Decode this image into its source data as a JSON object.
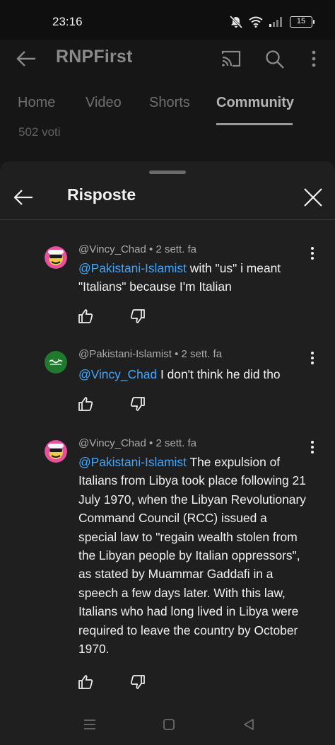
{
  "status_bar": {
    "time": "23:16",
    "battery": "15"
  },
  "header": {
    "channel_title": "RNPFirst"
  },
  "tabs": [
    {
      "label": "Home",
      "active": false
    },
    {
      "label": "Video",
      "active": false
    },
    {
      "label": "Shorts",
      "active": false
    },
    {
      "label": "Community",
      "active": true
    }
  ],
  "post": {
    "votes": "502 voti"
  },
  "sheet": {
    "title": "Risposte"
  },
  "comments": [
    {
      "author": "@Vincy_Chad",
      "time": "2 sett. fa",
      "mention": "@Pakistani-Islamist",
      "text": " with \"us\" i meant \"Italians\" because I'm Italian",
      "avatar": "cartoon-avatar"
    },
    {
      "author": "@Pakistani-Islamist",
      "time": "2 sett. fa",
      "mention": "@Vincy_Chad",
      "text": " I don't think he did tho",
      "avatar": "green-flag-avatar"
    },
    {
      "author": "@Vincy_Chad",
      "time": "2 sett. fa",
      "mention": "@Pakistani-Islamist",
      "text": " The expulsion of Italians from Libya took place following 21 July 1970, when the Libyan Revolutionary Command Council (RCC) issued a special law to \"regain wealth stolen from the Libyan people by Italian oppressors\", as stated by Muammar Gaddafi in a speech a few days later. With this law, Italians who had long lived in Libya were required to leave the country by October 1970.",
      "avatar": "cartoon-avatar"
    }
  ],
  "colors": {
    "mention": "#3ea6ff",
    "sheet_bg": "#1f1f1f",
    "page_bg": "#0f0f0f"
  }
}
